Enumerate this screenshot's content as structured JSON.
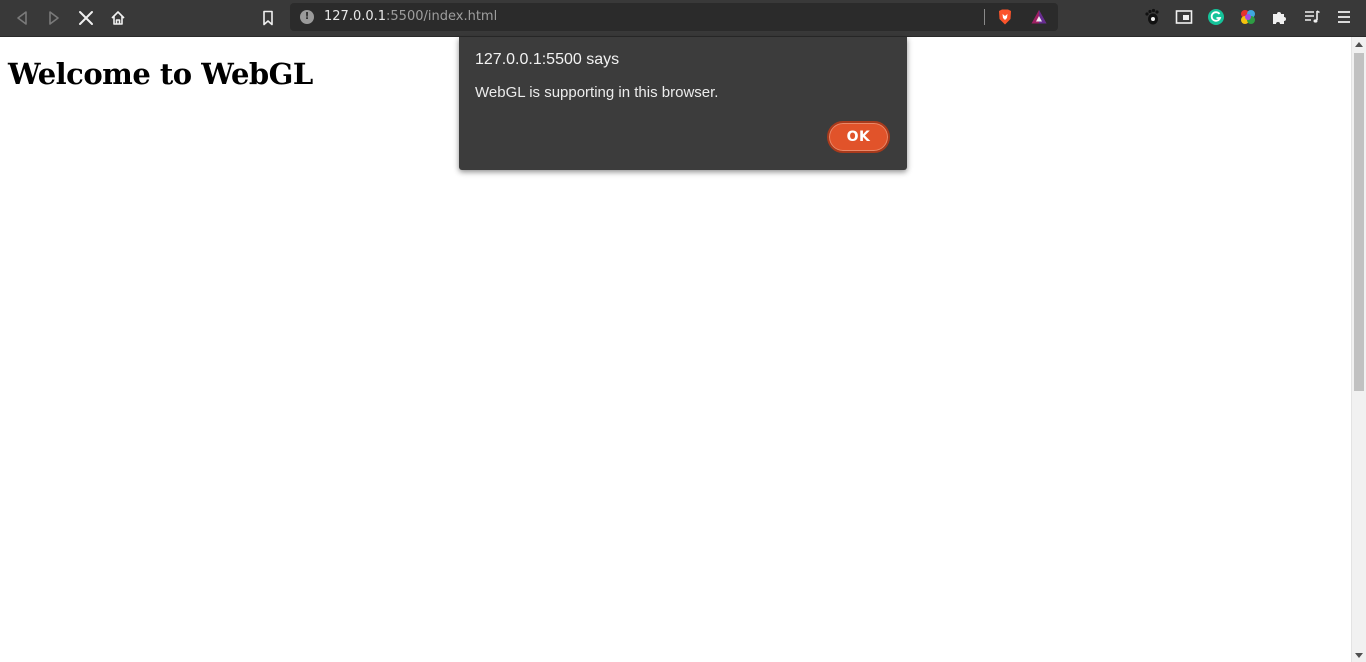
{
  "browser": {
    "url": {
      "host": "127.0.0.1",
      "path": ":5500/index.html"
    },
    "icons": {
      "back": "back-icon",
      "forward": "forward-icon",
      "stop": "stop-icon",
      "home": "home-icon",
      "bookmark": "bookmark-icon",
      "site_info": "info-icon",
      "brave_shields": "brave-shields-icon",
      "brave_rewards": "brave-rewards-icon"
    },
    "extensions": [
      "gnome-foot-icon",
      "picture-in-picture-icon",
      "grammarly-icon",
      "color-wheel-icon",
      "puzzle-icon",
      "playlist-icon",
      "menu-icon"
    ],
    "site_info_glyph": "!",
    "colors": {
      "toolbar": "#393939",
      "urlbar": "#2b2b2b",
      "grammarly": "#15c39a",
      "brave": "#fb542b"
    }
  },
  "page": {
    "heading": "Welcome to WebGL"
  },
  "dialog": {
    "title": "127.0.0.1:5500 says",
    "message": "WebGL is supporting in this browser.",
    "ok_label": "OK",
    "colors": {
      "background": "#3c3c3c",
      "ok": "#e1532a"
    }
  }
}
